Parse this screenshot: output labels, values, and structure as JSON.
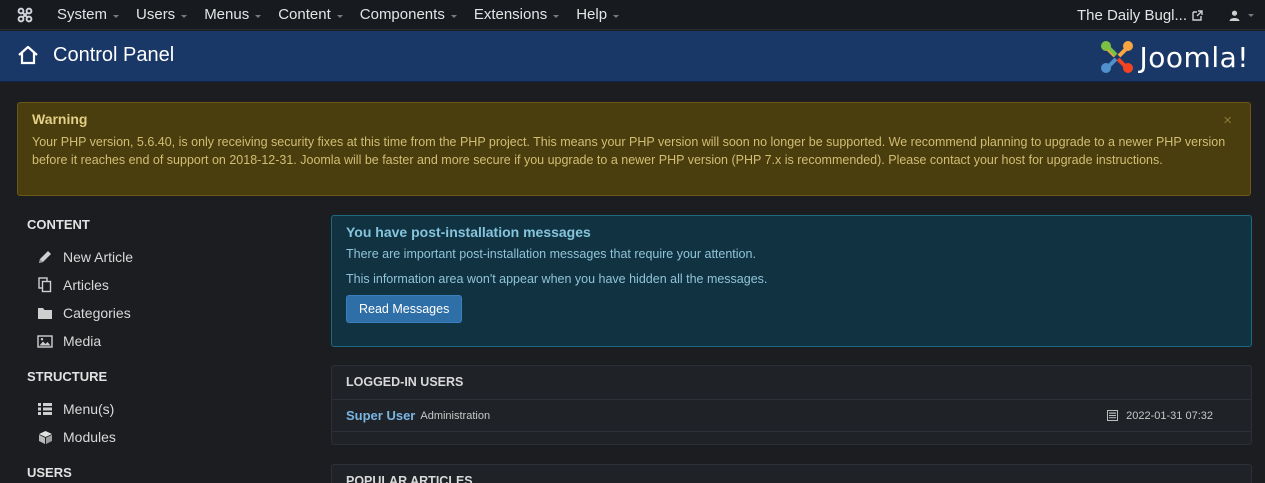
{
  "topnav": {
    "menus": [
      "System",
      "Users",
      "Menus",
      "Content",
      "Components",
      "Extensions",
      "Help"
    ],
    "site_name": "The Daily Bugl..."
  },
  "header": {
    "title": "Control Panel",
    "brand": "Joomla!"
  },
  "warning": {
    "title": "Warning",
    "message": "Your PHP version, 5.6.40, is only receiving security fixes at this time from the PHP project. This means your PHP version will soon no longer be supported. We recommend planning to upgrade to a newer PHP version before it reaches end of support on 2018-12-31. Joomla will be faster and more secure if you upgrade to a newer PHP version (PHP 7.x is recommended). Please contact your host for upgrade instructions.",
    "close": "×"
  },
  "sidebar": {
    "content_heading": "CONTENT",
    "content_items": [
      {
        "label": "New Article",
        "icon": "pencil-icon"
      },
      {
        "label": "Articles",
        "icon": "copy-icon"
      },
      {
        "label": "Categories",
        "icon": "folder-icon"
      },
      {
        "label": "Media",
        "icon": "image-icon"
      }
    ],
    "structure_heading": "STRUCTURE",
    "structure_items": [
      {
        "label": "Menu(s)",
        "icon": "list-icon"
      },
      {
        "label": "Modules",
        "icon": "cube-icon"
      }
    ],
    "users_heading": "USERS"
  },
  "postinstall": {
    "title": "You have post-installation messages",
    "line1": "There are important post-installation messages that require your attention.",
    "line2": "This information area won't appear when you have hidden all the messages.",
    "button": "Read Messages"
  },
  "logged_users": {
    "heading": "LOGGED-IN USERS",
    "rows": [
      {
        "name": "Super User",
        "role": "Administration",
        "date": "2022-01-31 07:32"
      }
    ]
  },
  "popular": {
    "heading": "POPULAR ARTICLES"
  },
  "colors": {
    "header_bg": "#1a3867",
    "warning_bg": "#4a3d0e",
    "info_bg": "#113241",
    "button_bg": "#2f6fa7"
  }
}
